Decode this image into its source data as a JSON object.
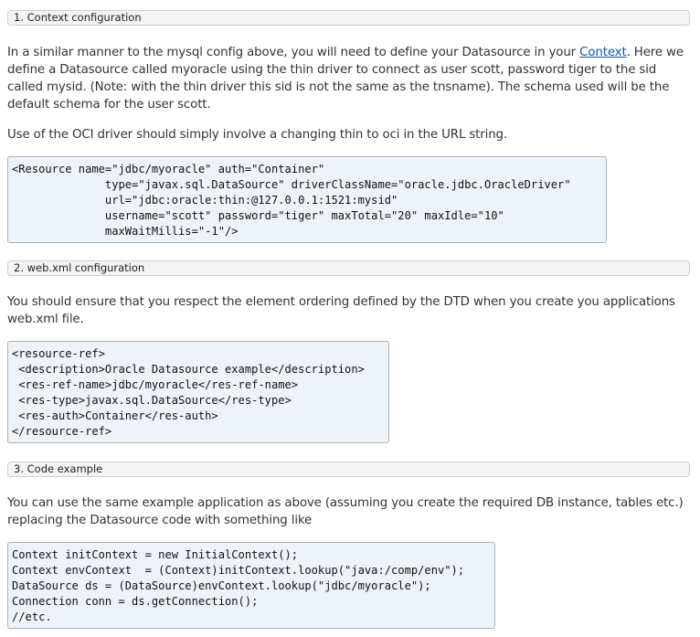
{
  "sections": [
    {
      "heading": "1. Context configuration",
      "para1_before": "In a similar manner to the mysql config above, you will need to define your Datasource in your ",
      "para1_link": "Context",
      "para1_after": ". Here we define a Datasource called myoracle using the thin driver to connect as user scott, password tiger to the sid called mysid. (Note: with the thin driver this sid is not the same as the tnsname). The schema used will be the default schema for the user scott.",
      "para2": "Use of the OCI driver should simply involve a changing thin to oci in the URL string.",
      "code": [
        "<Resource name=\"jdbc/myoracle\" auth=\"Container\"",
        "              type=\"javax.sql.DataSource\" driverClassName=\"oracle.jdbc.OracleDriver\"",
        "              url=\"jdbc:oracle:thin:@127.0.0.1:1521:mysid\"",
        "              username=\"scott\" password=\"tiger\" maxTotal=\"20\" maxIdle=\"10\"",
        "              maxWaitMillis=\"-1\"/>"
      ]
    },
    {
      "heading": "2. web.xml configuration",
      "para1": "You should ensure that you respect the element ordering defined by the DTD when you create you applications web.xml file.",
      "code": [
        "<resource-ref>",
        " <description>Oracle Datasource example</description>",
        " <res-ref-name>jdbc/myoracle</res-ref-name>",
        " <res-type>javax.sql.DataSource</res-type>",
        " <res-auth>Container</res-auth>",
        "</resource-ref>"
      ]
    },
    {
      "heading": "3. Code example",
      "para1": "You can use the same example application as above (assuming you create the required DB instance, tables etc.) replacing the Datasource code with something like",
      "code": [
        "Context initContext = new InitialContext();",
        "Context envContext  = (Context)initContext.lookup(\"java:/comp/env\");",
        "DataSource ds = (DataSource)envContext.lookup(\"jdbc/myoracle\");",
        "Connection conn = ds.getConnection();",
        "//etc."
      ]
    }
  ]
}
